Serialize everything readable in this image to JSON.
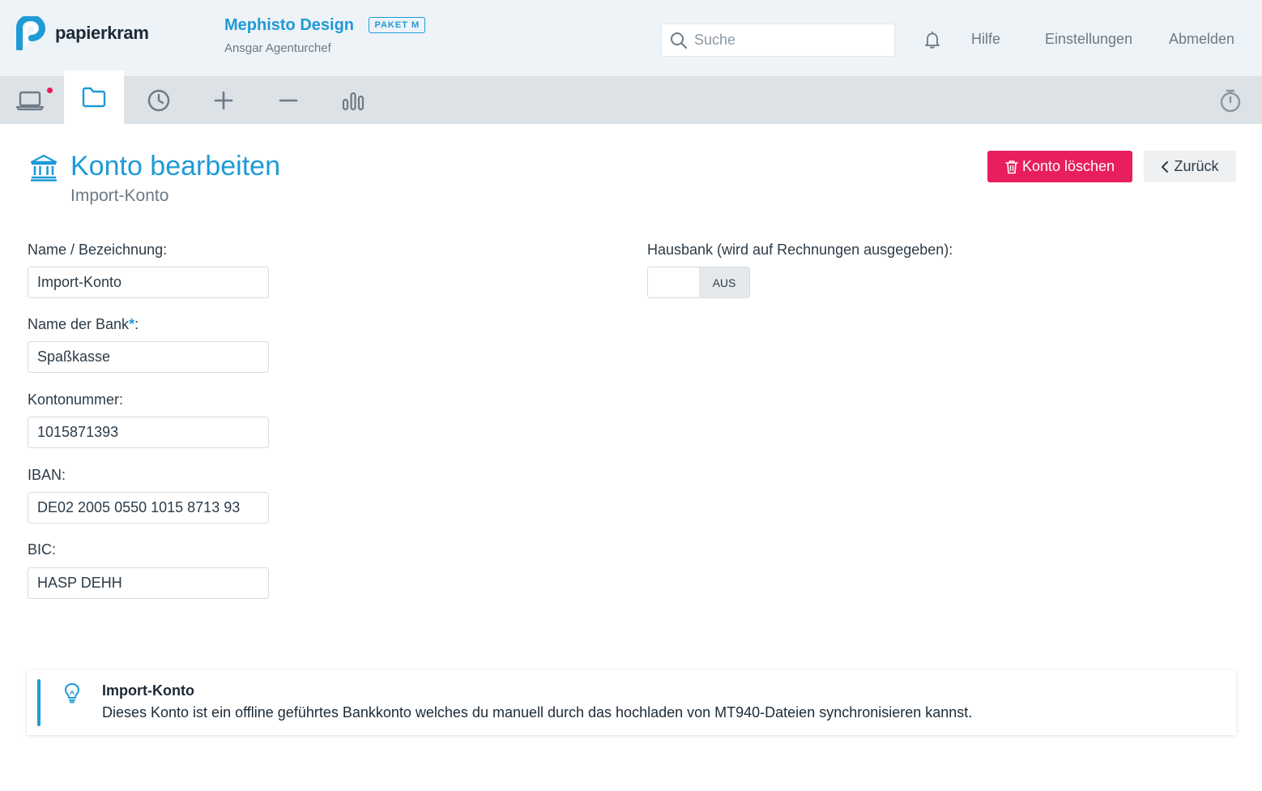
{
  "brand": {
    "name": "papierkram",
    "accent": "#1e9ad6"
  },
  "company": {
    "name": "Mephisto Design",
    "plan": "PAKET M",
    "user": "Ansgar Agenturchef"
  },
  "search": {
    "placeholder": "Suche"
  },
  "nav_links": {
    "help": "Hilfe",
    "settings": "Einstellungen",
    "logout": "Abmelden"
  },
  "toolbar": {
    "items": [
      {
        "icon": "laptop-icon",
        "has_notification": true
      },
      {
        "icon": "folder-icon",
        "active": true
      },
      {
        "icon": "clock-icon"
      },
      {
        "icon": "plus-icon"
      },
      {
        "icon": "minus-icon"
      },
      {
        "icon": "bar-chart-icon"
      }
    ],
    "right_icon": "stopwatch-icon"
  },
  "page": {
    "title": "Konto bearbeiten",
    "subtitle": "Import-Konto",
    "delete_label": "Konto löschen",
    "back_label": "Zurück"
  },
  "form": {
    "name_label": "Name / Bezeichnung:",
    "name_value": "Import-Konto",
    "bank_label": "Name der Bank",
    "bank_required": "*",
    "bank_suffix": ":",
    "bank_value": "Spaßkasse",
    "account_label": "Kontonummer:",
    "account_value": "1015871393",
    "iban_label": "IBAN:",
    "iban_value": "DE02 2005 0550 1015 8713 93",
    "bic_label": "BIC:",
    "bic_value": "HASP DEHH",
    "hausbank_label": "Hausbank (wird auf Rechnungen ausgegeben):",
    "hausbank_state": "AUS"
  },
  "info": {
    "title": "Import-Konto",
    "text": "Dieses Konto ist ein offline geführtes Bankkonto welches du manuell durch das hochladen von MT940-Dateien synchronisieren kannst."
  }
}
